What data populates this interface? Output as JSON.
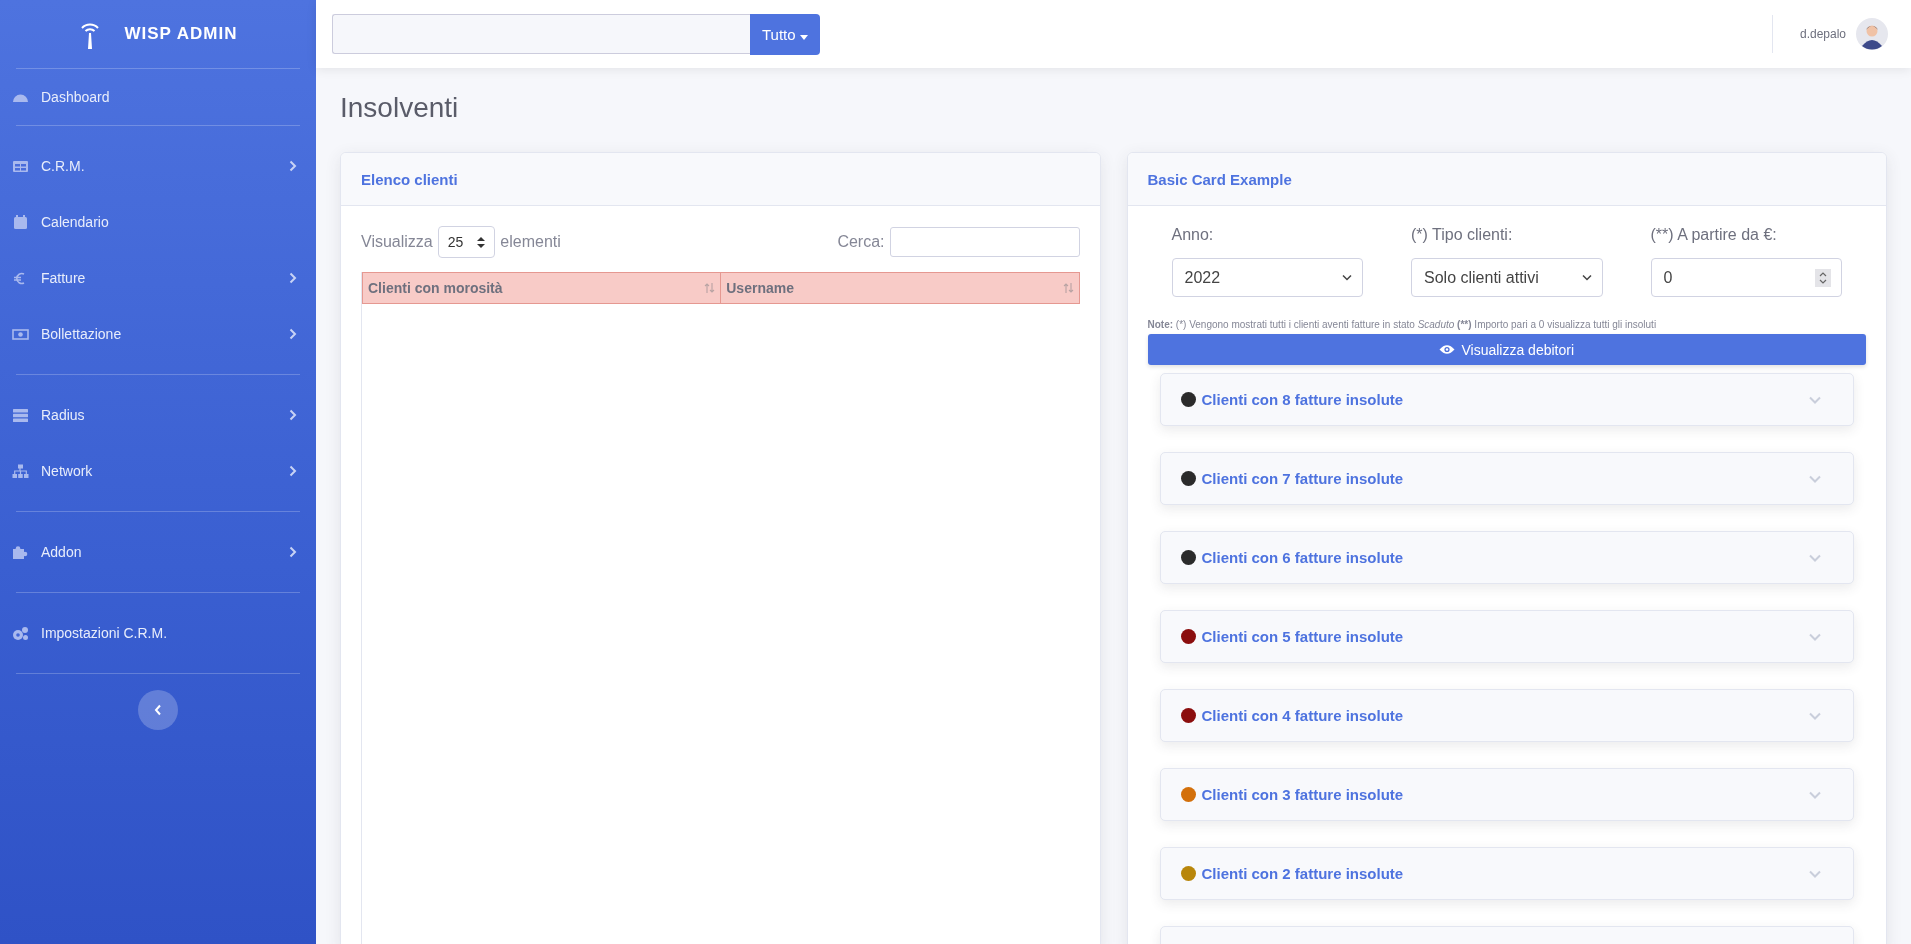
{
  "brand": {
    "title": "WISP ADMIN"
  },
  "sidebar": {
    "groups": [
      {
        "items": [
          {
            "label": "Dashboard",
            "has_submenu": false
          }
        ]
      },
      {
        "items": [
          {
            "label": "C.R.M.",
            "has_submenu": true
          },
          {
            "label": "Calendario",
            "has_submenu": false
          },
          {
            "label": "Fatture",
            "has_submenu": true
          },
          {
            "label": "Bollettazione",
            "has_submenu": true
          }
        ]
      },
      {
        "items": [
          {
            "label": "Radius",
            "has_submenu": true
          },
          {
            "label": "Network",
            "has_submenu": true
          }
        ]
      },
      {
        "items": [
          {
            "label": "Addon",
            "has_submenu": true
          }
        ]
      },
      {
        "items": [
          {
            "label": "Impostazioni C.R.M.",
            "has_submenu": false
          }
        ]
      }
    ]
  },
  "topbar": {
    "search_button": "Tutto",
    "username": "d.depalo"
  },
  "page_title": "Insolventi",
  "left_card": {
    "title": "Elenco clienti",
    "length_prefix": "Visualizza",
    "length_value": "25",
    "length_suffix": "elementi",
    "search_label": "Cerca:",
    "columns": [
      "Clienti con morosità",
      "Username"
    ]
  },
  "right_card": {
    "title": "Basic Card Example",
    "filters": [
      {
        "kind": "select",
        "label": "Anno:",
        "value": "2022"
      },
      {
        "kind": "select",
        "label": "(*) Tipo clienti:",
        "value": "Solo clienti attivi"
      },
      {
        "kind": "number",
        "label": "(**) A partire da €:",
        "value": "0"
      }
    ],
    "note": [
      {
        "kind": "strong",
        "text": "Note:"
      },
      {
        "kind": "normal",
        "text": " (*) Vengono mostrati tutti i clienti aventi fatture in stato "
      },
      {
        "kind": "emphasis",
        "text": "Scaduto"
      },
      {
        "kind": "strong",
        "text": " (**)"
      },
      {
        "kind": "normal",
        "text": " Importo pari a 0 visualizza tutti gli insoluti"
      }
    ],
    "button": "Visualizza debitori",
    "groups": [
      {
        "title": "Clienti con 8 fatture insolute",
        "color": "#2b2b2b",
        "expanded": false
      },
      {
        "title": "Clienti con 7 fatture insolute",
        "color": "#2b2b2b",
        "expanded": false
      },
      {
        "title": "Clienti con 6 fatture insolute",
        "color": "#2b2b2b",
        "expanded": false
      },
      {
        "title": "Clienti con 5 fatture insolute",
        "color": "#8b0e0e",
        "expanded": false
      },
      {
        "title": "Clienti con 4 fatture insolute",
        "color": "#8b0e0e",
        "expanded": false
      },
      {
        "title": "Clienti con 3 fatture insolute",
        "color": "#d3700b",
        "expanded": false
      },
      {
        "title": "Clienti con 2 fatture insolute",
        "color": "#b8860b",
        "expanded": false
      }
    ]
  }
}
